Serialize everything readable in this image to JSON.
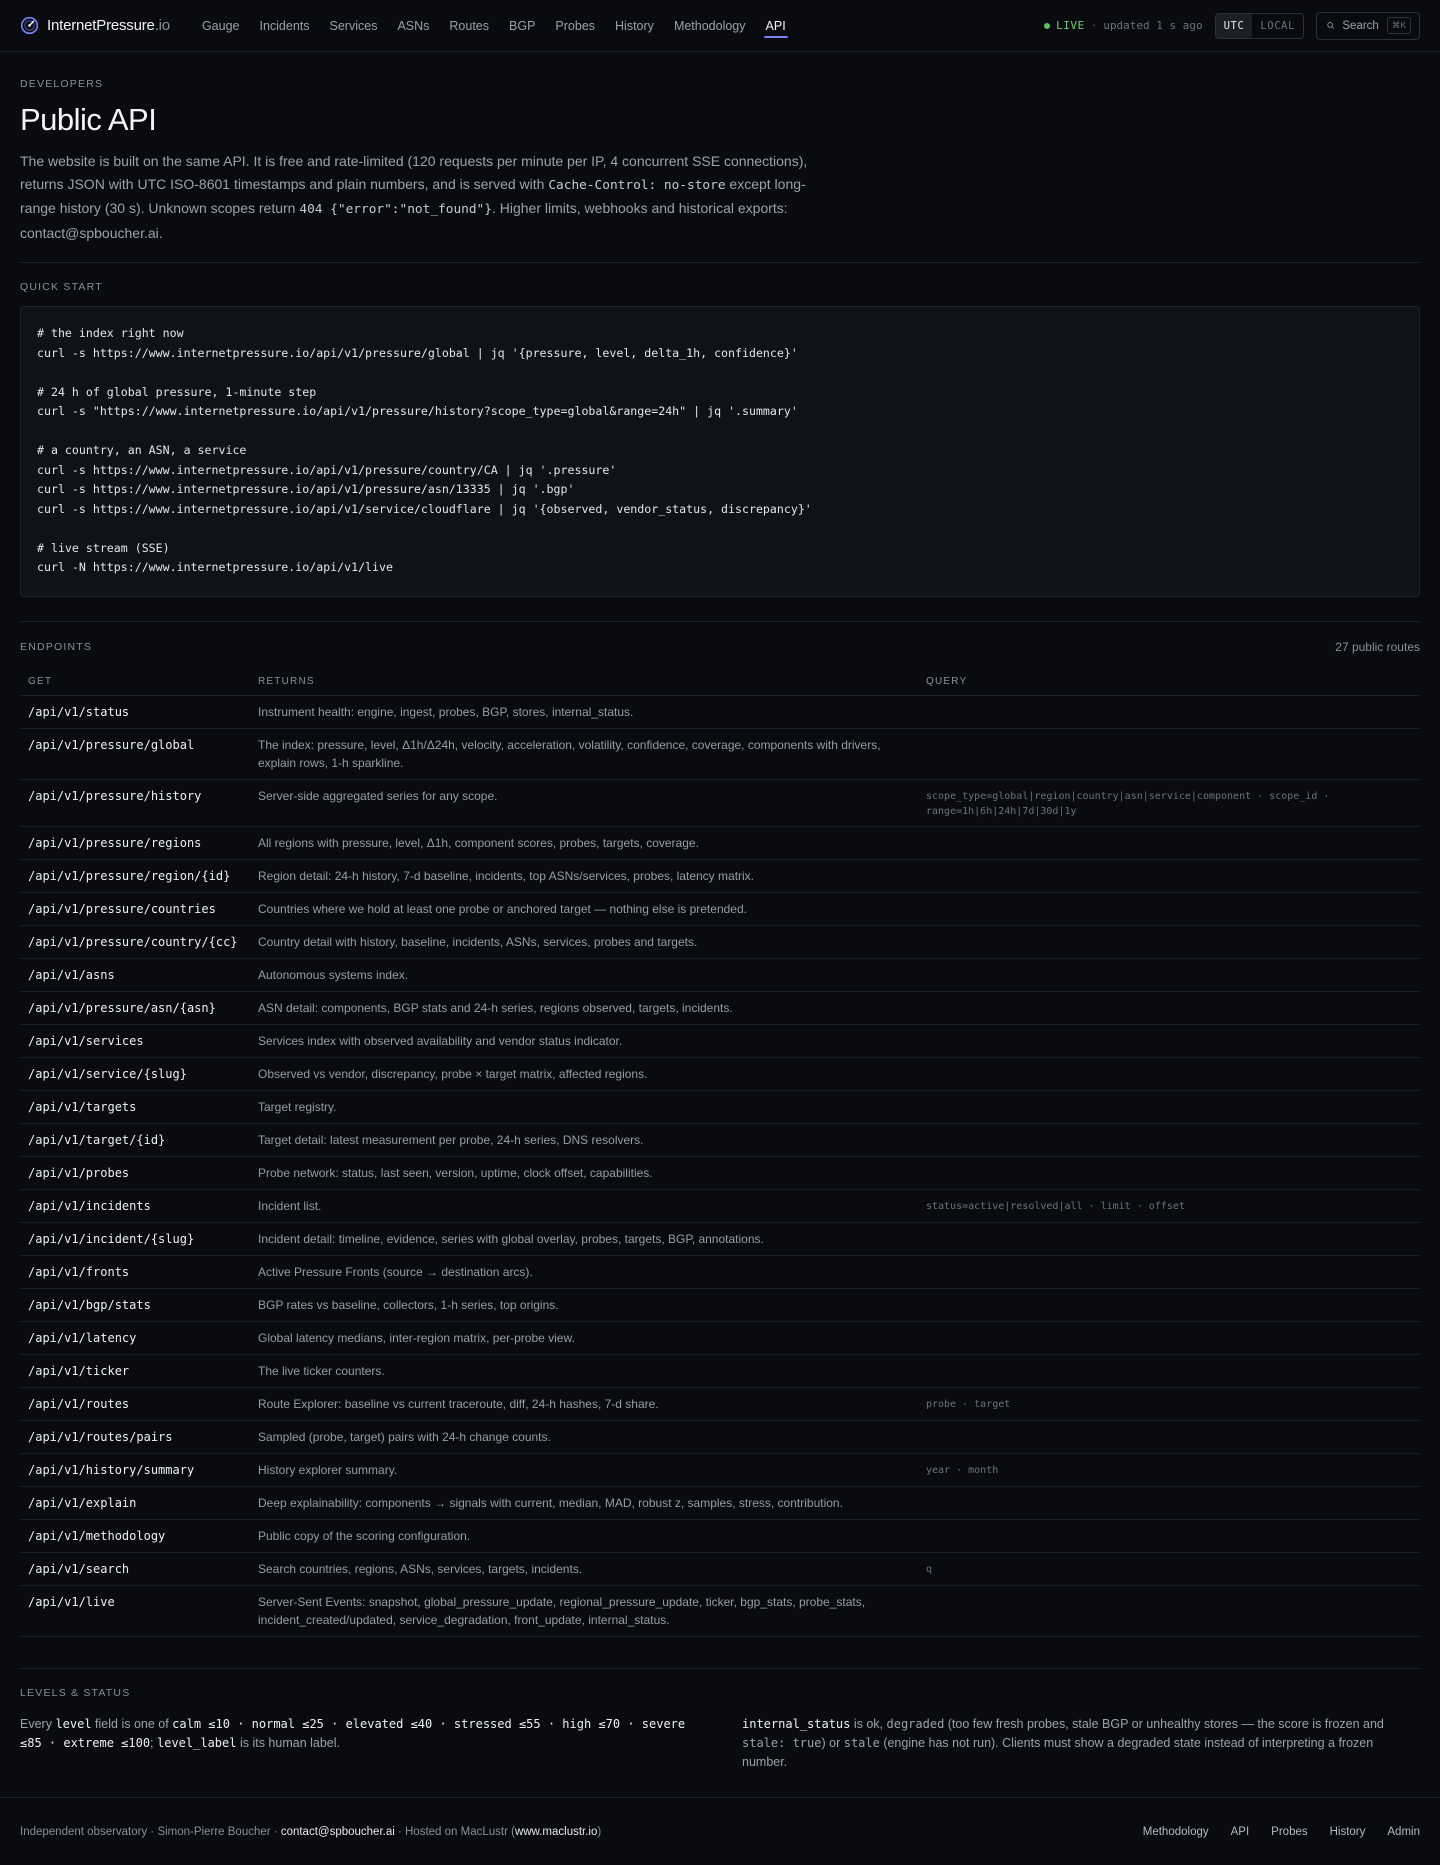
{
  "brand": {
    "name_main": "InternetPressure",
    "name_suffix": ".io"
  },
  "nav": [
    {
      "label": "Gauge"
    },
    {
      "label": "Incidents"
    },
    {
      "label": "Services"
    },
    {
      "label": "ASNs"
    },
    {
      "label": "Routes"
    },
    {
      "label": "BGP"
    },
    {
      "label": "Probes"
    },
    {
      "label": "History"
    },
    {
      "label": "Methodology"
    },
    {
      "label": "API",
      "active": true
    }
  ],
  "status": {
    "live": "LIVE",
    "sep": "·",
    "updated": "updated 1 s ago"
  },
  "timezone": {
    "utc": "UTC",
    "local": "LOCAL"
  },
  "search": {
    "label": "Search",
    "shortcut": "⌘K"
  },
  "intro": {
    "eyebrow": "DEVELOPERS",
    "title": "Public API",
    "p1": "The website is built on the same API. It is free and rate-limited (120 requests per minute per IP, 4 concurrent SSE connections), returns JSON with UTC ISO-8601 timestamps and plain numbers, and is served with ",
    "code1": "Cache-Control: no-store",
    "p2": " except long-range history (30 s). Unknown scopes return ",
    "code2": "404 {\"error\":\"not_found\"}",
    "p3": ". Higher limits, webhooks and historical exports: contact@spboucher.ai."
  },
  "quickstart": {
    "heading": "QUICK START",
    "blocks": [
      [
        "# the index right now",
        "curl -s https://www.internetpressure.io/api/v1/pressure/global | jq '{pressure, level, delta_1h, confidence}'"
      ],
      [
        "# 24 h of global pressure, 1-minute step",
        "curl -s \"https://www.internetpressure.io/api/v1/pressure/history?scope_type=global&range=24h\" | jq '.summary'"
      ],
      [
        "# a country, an ASN, a service",
        "curl -s https://www.internetpressure.io/api/v1/pressure/country/CA | jq '.pressure'",
        "curl -s https://www.internetpressure.io/api/v1/pressure/asn/13335 | jq '.bgp'",
        "curl -s https://www.internetpressure.io/api/v1/service/cloudflare | jq '{observed, vendor_status, discrepancy}'"
      ],
      [
        "# live stream (SSE)",
        "curl -N https://www.internetpressure.io/api/v1/live"
      ]
    ]
  },
  "endpoints": {
    "heading": "ENDPOINTS",
    "count": "27 public routes",
    "columns": {
      "get": "GET",
      "returns": "RETURNS",
      "query": "QUERY"
    },
    "rows": [
      {
        "path": "/api/v1/status",
        "returns": "Instrument health: engine, ingest, probes, BGP, stores, internal_status.",
        "query": ""
      },
      {
        "path": "/api/v1/pressure/global",
        "returns": "The index: pressure, level, Δ1h/Δ24h, velocity, acceleration, volatility, confidence, coverage, components with drivers, explain rows, 1-h sparkline.",
        "query": ""
      },
      {
        "path": "/api/v1/pressure/history",
        "returns": "Server-side aggregated series for any scope.",
        "query": "scope_type=global|region|country|asn|service|component · scope_id · range=1h|6h|24h|7d|30d|1y"
      },
      {
        "path": "/api/v1/pressure/regions",
        "returns": "All regions with pressure, level, Δ1h, component scores, probes, targets, coverage.",
        "query": ""
      },
      {
        "path": "/api/v1/pressure/region/{id}",
        "returns": "Region detail: 24-h history, 7-d baseline, incidents, top ASNs/services, probes, latency matrix.",
        "query": ""
      },
      {
        "path": "/api/v1/pressure/countries",
        "returns": "Countries where we hold at least one probe or anchored target — nothing else is pretended.",
        "query": ""
      },
      {
        "path": "/api/v1/pressure/country/{cc}",
        "returns": "Country detail with history, baseline, incidents, ASNs, services, probes and targets.",
        "query": ""
      },
      {
        "path": "/api/v1/asns",
        "returns": "Autonomous systems index.",
        "query": ""
      },
      {
        "path": "/api/v1/pressure/asn/{asn}",
        "returns": "ASN detail: components, BGP stats and 24-h series, regions observed, targets, incidents.",
        "query": ""
      },
      {
        "path": "/api/v1/services",
        "returns": "Services index with observed availability and vendor status indicator.",
        "query": ""
      },
      {
        "path": "/api/v1/service/{slug}",
        "returns": "Observed vs vendor, discrepancy, probe × target matrix, affected regions.",
        "query": ""
      },
      {
        "path": "/api/v1/targets",
        "returns": "Target registry.",
        "query": ""
      },
      {
        "path": "/api/v1/target/{id}",
        "returns": "Target detail: latest measurement per probe, 24-h series, DNS resolvers.",
        "query": ""
      },
      {
        "path": "/api/v1/probes",
        "returns": "Probe network: status, last seen, version, uptime, clock offset, capabilities.",
        "query": ""
      },
      {
        "path": "/api/v1/incidents",
        "returns": "Incident list.",
        "query": "status=active|resolved|all · limit · offset"
      },
      {
        "path": "/api/v1/incident/{slug}",
        "returns": "Incident detail: timeline, evidence, series with global overlay, probes, targets, BGP, annotations.",
        "query": ""
      },
      {
        "path": "/api/v1/fronts",
        "returns": "Active Pressure Fronts (source → destination arcs).",
        "query": ""
      },
      {
        "path": "/api/v1/bgp/stats",
        "returns": "BGP rates vs baseline, collectors, 1-h series, top origins.",
        "query": ""
      },
      {
        "path": "/api/v1/latency",
        "returns": "Global latency medians, inter-region matrix, per-probe view.",
        "query": ""
      },
      {
        "path": "/api/v1/ticker",
        "returns": "The live ticker counters.",
        "query": ""
      },
      {
        "path": "/api/v1/routes",
        "returns": "Route Explorer: baseline vs current traceroute, diff, 24-h hashes, 7-d share.",
        "query": "probe · target"
      },
      {
        "path": "/api/v1/routes/pairs",
        "returns": "Sampled (probe, target) pairs with 24-h change counts.",
        "query": ""
      },
      {
        "path": "/api/v1/history/summary",
        "returns": "History explorer summary.",
        "query": "year · month"
      },
      {
        "path": "/api/v1/explain",
        "returns": "Deep explainability: components → signals with current, median, MAD, robust z, samples, stress, contribution.",
        "query": ""
      },
      {
        "path": "/api/v1/methodology",
        "returns": "Public copy of the scoring configuration.",
        "query": ""
      },
      {
        "path": "/api/v1/search",
        "returns": "Search countries, regions, ASNs, services, targets, incidents.",
        "query": "q"
      },
      {
        "path": "/api/v1/live",
        "returns": "Server-Sent Events: snapshot, global_pressure_update, regional_pressure_update, ticker, bgp_stats, probe_stats, incident_created/updated, service_degradation, front_update, internal_status.",
        "query": ""
      }
    ]
  },
  "levels": {
    "heading": "LEVELS & STATUS",
    "left": {
      "t1": "Every ",
      "c1": "level",
      "t2": " field is one of ",
      "c2": "calm ≤10 · normal ≤25 · elevated ≤40 · stressed ≤55 · high ≤70 · severe ≤85 · extreme ≤100",
      "t3": "; ",
      "c3": "level_label",
      "t4": " is its human label."
    },
    "right": {
      "c1": "internal_status",
      "t1": " is ok, ",
      "c2": "degraded",
      "t2": " (too few fresh probes, stale BGP or unhealthy stores — the score is frozen and ",
      "c3": "stale: true",
      "t3": ") or ",
      "c4": "stale",
      "t4": " (engine has not run). Clients must show a degraded state instead of interpreting a frozen number."
    }
  },
  "footer": {
    "t1": "Independent observatory · Simon-Pierre Boucher · ",
    "email": "contact@spboucher.ai",
    "t2": " · Hosted on MacLustr (",
    "host": "www.maclustr.io",
    "t3": ")",
    "links": [
      "Methodology",
      "API",
      "Probes",
      "History",
      "Admin"
    ]
  }
}
